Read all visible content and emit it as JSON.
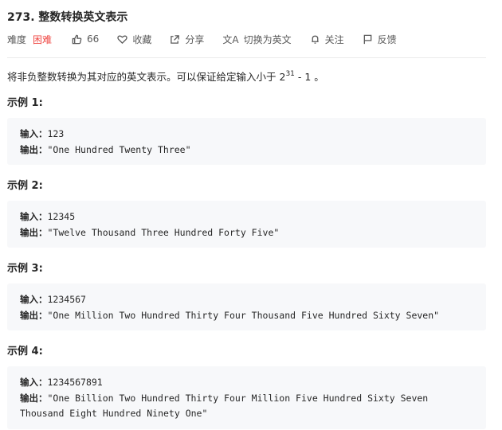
{
  "problem": {
    "title": "273. 整数转换英文表示",
    "difficulty_label": "难度",
    "difficulty_value": "困难",
    "likes": "66",
    "favorite_label": "收藏",
    "share_label": "分享",
    "translate_label": "切换为英文",
    "follow_label": "关注",
    "feedback_label": "反馈",
    "colors": {
      "difficulty_hard": "#ef4743",
      "code_bg": "#f7f8fa"
    }
  },
  "description": {
    "text_before": "将非负整数转换为其对应的英文表示。可以保证给定输入小于 2",
    "exponent": "31",
    "text_after": " - 1 。"
  },
  "labels": {
    "input": "输入：",
    "output": "输出："
  },
  "examples": [
    {
      "title": "示例 1:",
      "input": "123",
      "output": "\"One Hundred Twenty Three\""
    },
    {
      "title": "示例 2:",
      "input": "12345",
      "output": "\"Twelve Thousand Three Hundred Forty Five\""
    },
    {
      "title": "示例 3:",
      "input": "1234567",
      "output": "\"One Million Two Hundred Thirty Four Thousand Five Hundred Sixty Seven\""
    },
    {
      "title": "示例 4:",
      "input": "1234567891",
      "output": "\"One Billion Two Hundred Thirty Four Million Five Hundred Sixty Seven",
      "output_cont": "Thousand Eight Hundred Ninety One\""
    }
  ]
}
